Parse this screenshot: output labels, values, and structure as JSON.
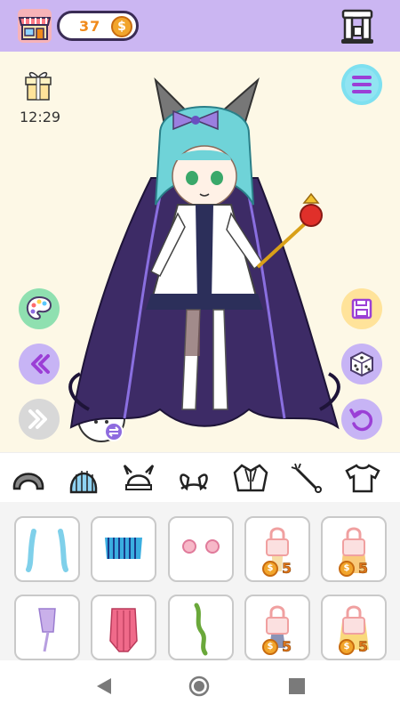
{
  "header": {
    "coins": "37",
    "coin_symbol": "$"
  },
  "stage": {
    "time": "12:29"
  },
  "categories": [
    "hair-base",
    "hair-back",
    "headwear",
    "ears",
    "jacket",
    "props",
    "shirt"
  ],
  "items_row1": [
    {
      "name": "bangs-blue",
      "locked": false
    },
    {
      "name": "hair-blue-back",
      "locked": false
    },
    {
      "name": "hair-pink-buns",
      "locked": false
    },
    {
      "name": "locked-item-4",
      "locked": true,
      "price": "5"
    },
    {
      "name": "locked-item-5",
      "locked": true,
      "price": "5"
    }
  ],
  "items_row2": [
    {
      "name": "braid-lavender",
      "locked": false
    },
    {
      "name": "hair-pink-long",
      "locked": false
    },
    {
      "name": "braid-green",
      "locked": false
    },
    {
      "name": "locked-item-9",
      "locked": true,
      "price": "5"
    },
    {
      "name": "locked-item-10",
      "locked": true,
      "price": "5"
    }
  ],
  "colors": {
    "topbar": "#cbb6f2",
    "stage_bg": "#fdf8e6",
    "accent_purple": "#9b6be0",
    "coin": "#f2a52b"
  }
}
